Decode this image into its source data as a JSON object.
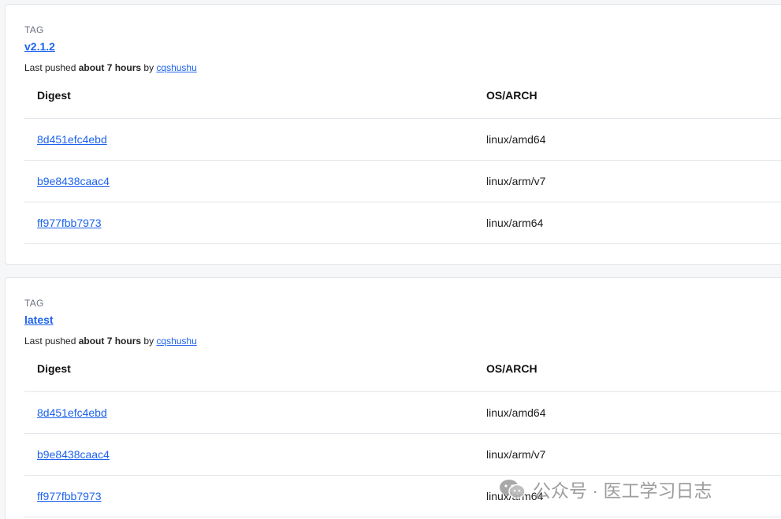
{
  "tags": [
    {
      "label": "TAG",
      "name": "v2.1.2",
      "pushed_prefix": "Last pushed ",
      "pushed_time": "about 7 hours",
      "pushed_by": " by ",
      "pushed_user": "cqshushu",
      "columns": {
        "digest": "Digest",
        "os": "OS/ARCH"
      },
      "rows": [
        {
          "digest": "8d451efc4ebd",
          "os": "linux/amd64"
        },
        {
          "digest": "b9e8438caac4",
          "os": "linux/arm/v7"
        },
        {
          "digest": "ff977fbb7973",
          "os": "linux/arm64"
        }
      ]
    },
    {
      "label": "TAG",
      "name": "latest",
      "pushed_prefix": "Last pushed ",
      "pushed_time": "about 7 hours",
      "pushed_by": " by ",
      "pushed_user": "cqshushu",
      "columns": {
        "digest": "Digest",
        "os": "OS/ARCH"
      },
      "rows": [
        {
          "digest": "8d451efc4ebd",
          "os": "linux/amd64"
        },
        {
          "digest": "b9e8438caac4",
          "os": "linux/arm/v7"
        },
        {
          "digest": "ff977fbb7973",
          "os": "linux/arm64"
        }
      ]
    }
  ],
  "watermark": {
    "text": "公众号 · 医工学习日志",
    "icon": "wechat-icon"
  },
  "colors": {
    "link": "#1d63ed",
    "border": "#e3e6ea",
    "muted": "#6b7280"
  }
}
